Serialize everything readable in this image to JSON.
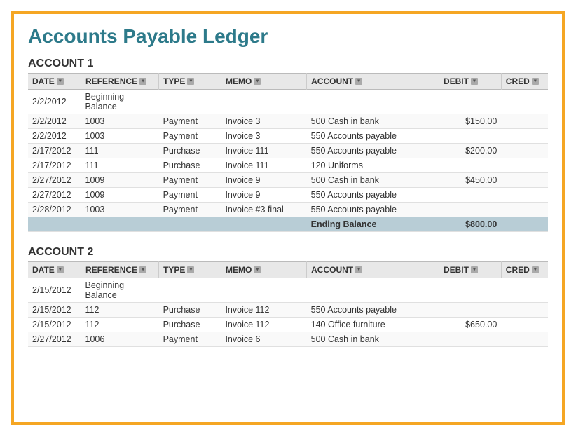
{
  "title": "Accounts Payable Ledger",
  "accounts": [
    {
      "heading": "ACCOUNT 1",
      "columns": [
        "DATE",
        "REFERENCE",
        "TYPE",
        "MEMO",
        "ACCOUNT",
        "DEBIT",
        "CRED"
      ],
      "rows": [
        {
          "date": "2/2/2012",
          "reference": "Beginning Balance",
          "type": "",
          "memo": "",
          "account": "",
          "debit": "",
          "cred": ""
        },
        {
          "date": "2/2/2012",
          "reference": "1003",
          "type": "Payment",
          "memo": "Invoice 3",
          "account": "500 Cash in bank",
          "debit": "$150.00",
          "cred": ""
        },
        {
          "date": "2/2/2012",
          "reference": "1003",
          "type": "Payment",
          "memo": "Invoice 3",
          "account": "550 Accounts payable",
          "debit": "",
          "cred": ""
        },
        {
          "date": "2/17/2012",
          "reference": "111",
          "type": "Purchase",
          "memo": "Invoice 111",
          "account": "550 Accounts payable",
          "debit": "$200.00",
          "cred": ""
        },
        {
          "date": "2/17/2012",
          "reference": "111",
          "type": "Purchase",
          "memo": "Invoice 111",
          "account": "120 Uniforms",
          "debit": "",
          "cred": ""
        },
        {
          "date": "2/27/2012",
          "reference": "1009",
          "type": "Payment",
          "memo": "Invoice 9",
          "account": "500 Cash in bank",
          "debit": "$450.00",
          "cred": ""
        },
        {
          "date": "2/27/2012",
          "reference": "1009",
          "type": "Payment",
          "memo": "Invoice 9",
          "account": "550 Accounts payable",
          "debit": "",
          "cred": ""
        },
        {
          "date": "2/28/2012",
          "reference": "1003",
          "type": "Payment",
          "memo": "Invoice #3 final",
          "account": "550 Accounts payable",
          "debit": "",
          "cred": ""
        },
        {
          "date": "",
          "reference": "",
          "type": "",
          "memo": "",
          "account": "Ending Balance",
          "debit": "$800.00",
          "cred": "",
          "isEnding": true
        }
      ]
    },
    {
      "heading": "ACCOUNT 2",
      "columns": [
        "DATE",
        "REFERENCE",
        "TYPE",
        "MEMO",
        "ACCOUNT",
        "DEBIT",
        "CRED"
      ],
      "rows": [
        {
          "date": "2/15/2012",
          "reference": "Beginning Balance",
          "type": "",
          "memo": "",
          "account": "",
          "debit": "",
          "cred": ""
        },
        {
          "date": "2/15/2012",
          "reference": "112",
          "type": "Purchase",
          "memo": "Invoice 112",
          "account": "550 Accounts payable",
          "debit": "",
          "cred": ""
        },
        {
          "date": "2/15/2012",
          "reference": "112",
          "type": "Purchase",
          "memo": "Invoice 112",
          "account": "140 Office furniture",
          "debit": "$650.00",
          "cred": ""
        },
        {
          "date": "2/27/2012",
          "reference": "1006",
          "type": "Payment",
          "memo": "Invoice 6",
          "account": "500 Cash in bank",
          "debit": "",
          "cred": ""
        }
      ]
    }
  ]
}
